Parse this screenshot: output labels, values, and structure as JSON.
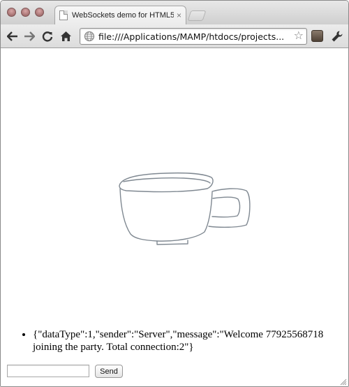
{
  "tab": {
    "title": "WebSockets demo for HTML5",
    "close_glyph": "×"
  },
  "toolbar": {
    "url": "file:///Applications/MAMP/htdocs/projects..."
  },
  "icons": {
    "back": "back-arrow-icon",
    "forward": "forward-arrow-icon",
    "reload": "reload-icon",
    "home": "home-icon",
    "page": "globe-icon",
    "bookmark": "star-icon",
    "extension": "extension-icon",
    "menu": "wrench-icon"
  },
  "messages": [
    "{\"dataType\":1,\"sender\":\"Server\",\"message\":\"Welcome 77925568718 joining the party. Total connection:2\"}"
  ],
  "form": {
    "input_value": "",
    "send_label": "Send"
  },
  "colors": {
    "drawing_stroke": "#7f8891",
    "chrome_frame": "#dcdcdc"
  }
}
